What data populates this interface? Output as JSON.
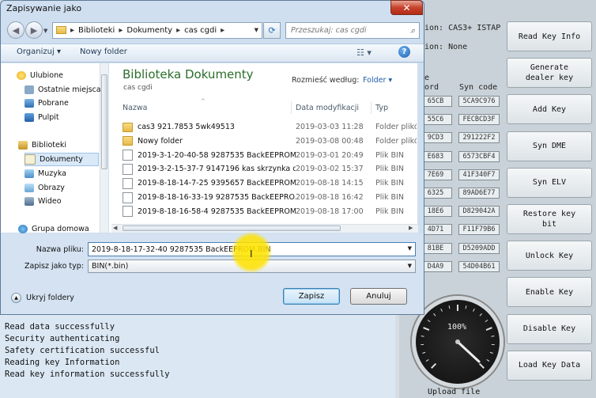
{
  "dialog": {
    "title": "Zapisywanie jako",
    "close_symbol": "✕",
    "address": [
      "Biblioteki",
      "Dokumenty",
      "cas cgdi"
    ],
    "search_placeholder": "Przeszukaj: cas cgdi",
    "toolbar": {
      "organize": "Organizuj ▾",
      "new_folder": "Nowy folder"
    },
    "nav": {
      "favorites": "Ulubione",
      "items_fav": [
        "Ostatnie miejsca",
        "Pobrane",
        "Pulpit"
      ],
      "libraries": "Biblioteki",
      "items_lib": [
        "Dokumenty",
        "Muzyka",
        "Obrazy",
        "Wideo"
      ],
      "homegroup": "Grupa domowa"
    },
    "library": {
      "title": "Biblioteka Dokumenty",
      "subtitle": "cas cgdi",
      "arrange_label": "Rozmieść według:",
      "arrange_value": "Folder ▾"
    },
    "columns": {
      "name": "Nazwa",
      "date": "Data modyfikacji",
      "type": "Typ"
    },
    "files": [
      {
        "name": "cas3 921.7853 5wk49513",
        "date": "2019-03-03 11:28",
        "type": "Folder plików",
        "kind": "folder"
      },
      {
        "name": "Nowy folder",
        "date": "2019-03-08 00:48",
        "type": "Folder plików",
        "kind": "folder"
      },
      {
        "name": "2019-3-1-20-40-58 9287535 BackEEPROM.BIN",
        "date": "2019-03-01 20:49",
        "type": "Plik BIN",
        "kind": "file"
      },
      {
        "name": "2019-3-2-15-37-7 9147196  kas skrzynka d...",
        "date": "2019-03-02 15:37",
        "type": "Plik BIN",
        "kind": "file"
      },
      {
        "name": "2019-8-18-14-7-25 9395657 BackEEPROM.BIN",
        "date": "2019-08-18 14:15",
        "type": "Plik BIN",
        "kind": "file"
      },
      {
        "name": "2019-8-18-16-33-19 9287535 BackEEPRO...",
        "date": "2019-08-18 16:42",
        "type": "Plik BIN",
        "kind": "file"
      },
      {
        "name": "2019-8-18-16-58-4 9287535 BackEEPROM...",
        "date": "2019-08-18 17:00",
        "type": "Plik BIN",
        "kind": "file"
      }
    ],
    "filename_label": "Nazwa pliku:",
    "filename_value": "2019-8-18-17-32-40 9287535 BackEEPROM.BIN",
    "filetype_label": "Zapisz jako typ:",
    "filetype_value": "BIN(*.bin)",
    "hide_folders": "Ukryj foldery",
    "save": "Zapisz",
    "cancel": "Anuluj"
  },
  "app": {
    "info_line1": "ion: CAS3+ ISTAP",
    "info_line2": "ion: None",
    "col_label_1": "e",
    "col_label_2": "ord",
    "col_label_3": "Syn code",
    "codes_left": [
      "65CB",
      "55C6",
      "9CD3",
      "E683",
      "7E69",
      "6325",
      "18E6",
      "4D71",
      "81BE",
      "D4A9"
    ],
    "codes_right": [
      "5CA9C976",
      "FECBCD3F",
      "291222F2",
      "6573CBF4",
      "41F340F7",
      "89AD6E77",
      "D829042A",
      "F11F79B6",
      "D5209ADD",
      "54D04B61"
    ],
    "buttons": [
      "Read Key Info",
      "Generate\ndealer key",
      "Add Key",
      "Syn DME",
      "Syn ELV",
      "Restore key\nbit",
      "Unlock Key",
      "Enable Key",
      "Disable Key",
      "Load Key Data"
    ],
    "gauge_percent": "100%",
    "upload_label": "Upload file",
    "log": [
      "Read data successfully",
      "Security authenticating",
      "Safety certification successful",
      "Reading key Information",
      "Read key information successfully"
    ]
  },
  "icons": [
    "folder-icon",
    "back-arrow-icon",
    "forward-arrow-icon",
    "refresh-icon",
    "search-icon",
    "view-icon",
    "help-icon",
    "star-icon",
    "library-icon",
    "homegroup-icon",
    "chevron-down-icon"
  ]
}
